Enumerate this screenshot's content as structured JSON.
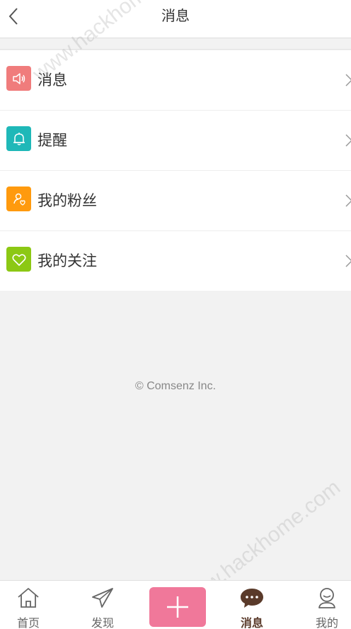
{
  "header": {
    "title": "消息"
  },
  "list": {
    "items": [
      {
        "label": "消息",
        "icon": "speaker-icon",
        "color": "#f07c7c"
      },
      {
        "label": "提醒",
        "icon": "bell-icon",
        "color": "#1fb8b8"
      },
      {
        "label": "我的粉丝",
        "icon": "fans-icon",
        "color": "#ff9a0e"
      },
      {
        "label": "我的关注",
        "icon": "heart-icon",
        "color": "#8cc814"
      }
    ]
  },
  "footer": {
    "copyright": "© Comsenz Inc."
  },
  "tabbar": {
    "tabs": [
      {
        "label": "首页",
        "icon": "home-icon",
        "active": false
      },
      {
        "label": "发现",
        "icon": "paper-plane-icon",
        "active": false
      },
      {
        "label": "",
        "icon": "plus-icon",
        "active": false
      },
      {
        "label": "消息",
        "icon": "chat-bubble-icon",
        "active": true
      },
      {
        "label": "我的",
        "icon": "user-icon",
        "active": false
      }
    ],
    "accent": "#f0789a",
    "active_color": "#5a3a2a"
  },
  "watermark": {
    "text": "www.hackhome.com"
  }
}
